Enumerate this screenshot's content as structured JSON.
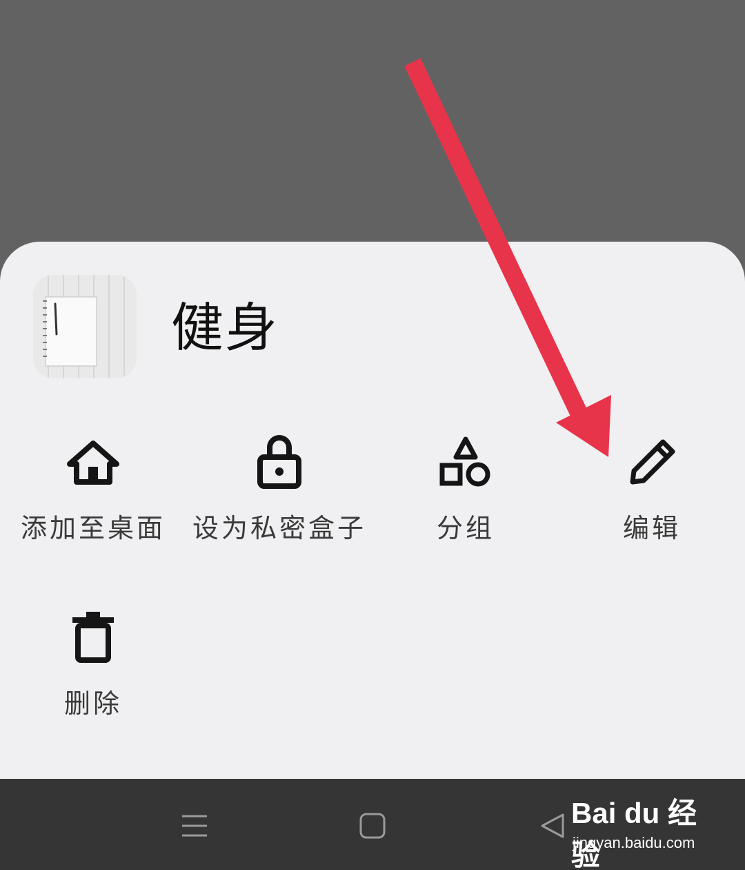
{
  "sheet": {
    "thumbnail_icon": "notebook-thumbnail",
    "title": "健身",
    "actions": [
      {
        "label": "添加至桌面",
        "icon": "home-icon"
      },
      {
        "label": "设为私密盒子",
        "icon": "lock-icon"
      },
      {
        "label": "分组",
        "icon": "shapes-icon"
      },
      {
        "label": "编辑",
        "icon": "pencil-icon"
      },
      {
        "label": "删除",
        "icon": "trash-icon"
      }
    ]
  },
  "navbar": {
    "buttons": [
      "menu-icon",
      "home-square-icon",
      "back-triangle-icon"
    ]
  },
  "watermark": {
    "logo": "Bai du 经验",
    "url": "jingyan.baidu.com"
  },
  "colors": {
    "backdrop": "#636263",
    "sheet": "#f0eff1",
    "navbar": "#353535",
    "annotation_arrow": "#e8344a",
    "icon": "#151515"
  }
}
